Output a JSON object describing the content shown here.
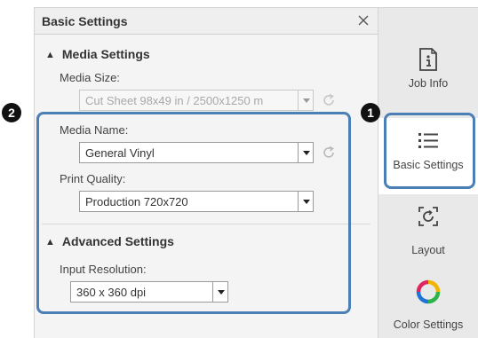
{
  "panel": {
    "title": "Basic Settings",
    "close_glyph": "×"
  },
  "media_settings": {
    "header": "Media Settings",
    "media_size_label": "Media Size:",
    "media_size_value": "Cut Sheet 98x49 in / 2500x1250 m",
    "media_name_label": "Media Name:",
    "media_name_value": "General Vinyl",
    "print_quality_label": "Print Quality:",
    "print_quality_value": "Production 720x720"
  },
  "advanced_settings": {
    "header": "Advanced Settings",
    "input_resolution_label": "Input Resolution:",
    "input_resolution_value": "360 x 360 dpi"
  },
  "tabs": [
    {
      "label": "Job Info",
      "icon": "info-document-icon"
    },
    {
      "label": "Basic Settings",
      "icon": "list-icon",
      "active": true
    },
    {
      "label": "Layout",
      "icon": "layout-icon"
    },
    {
      "label": "Color Settings",
      "icon": "color-wheel-icon"
    }
  ],
  "callouts": {
    "one": "1",
    "two": "2"
  },
  "colors": {
    "highlight": "#4b7fb5",
    "panel_bg": "#f4f4f4",
    "sidebar_bg": "#e9e9e9"
  }
}
